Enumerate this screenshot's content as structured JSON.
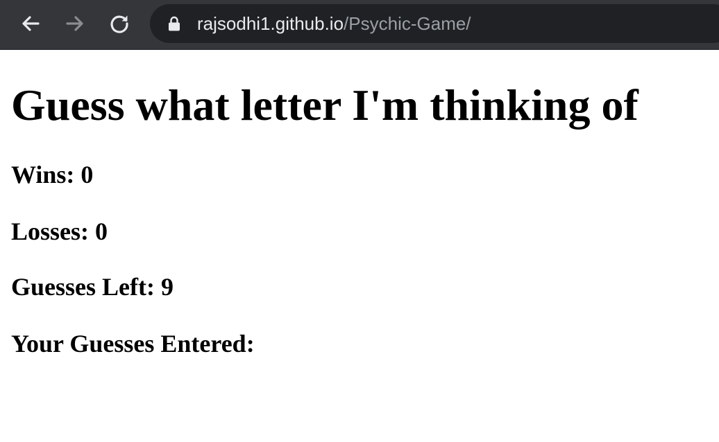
{
  "browser": {
    "url_host": "rajsodhi1.github.io",
    "url_path": "/Psychic-Game/",
    "icons": [
      "back-arrow-icon",
      "forward-arrow-icon",
      "reload-icon",
      "lock-icon"
    ]
  },
  "page": {
    "title": "Guess what letter I'm thinking of",
    "wins_label": "Wins:",
    "wins_value": "0",
    "losses_label": "Losses:",
    "losses_value": "0",
    "guesses_left_label": "Guesses Left:",
    "guesses_left_value": "9",
    "guesses_entered_label": "Your Guesses Entered:",
    "guesses_entered_value": ""
  }
}
